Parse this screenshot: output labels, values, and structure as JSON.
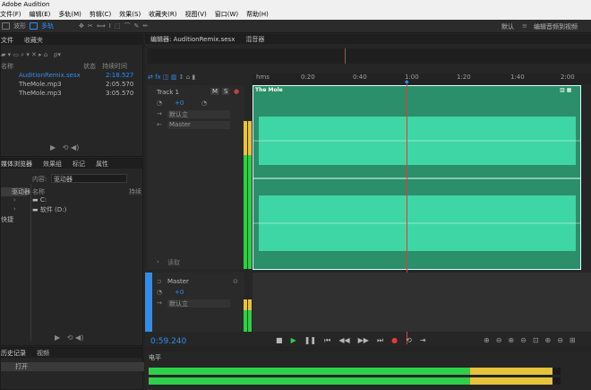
{
  "app": {
    "title": "Adobe Audition"
  },
  "menu": [
    "文件(F)",
    "编辑(E)",
    "多轨(M)",
    "剪辑(C)",
    "效果(S)",
    "收藏夹(R)",
    "视图(V)",
    "窗口(W)",
    "帮助(H)"
  ],
  "toolbar": {
    "waveform_label": "波形",
    "multitrack_label": "多轨",
    "default_label": "默认",
    "edit_audio_video_label": "编辑音频到视频"
  },
  "files_panel": {
    "tabs": [
      "文件",
      "收藏夹"
    ],
    "columns": [
      "名称",
      "状态",
      "持续时间"
    ],
    "files": [
      {
        "name": "AuditionRemix.sesx",
        "duration": "2:18.527",
        "active": true
      },
      {
        "name": "TheMole.mp3",
        "duration": "2:05.570",
        "active": false
      },
      {
        "name": "TheMole.mp3",
        "duration": "3:05.570",
        "active": false
      }
    ]
  },
  "media_panel": {
    "tabs": [
      "媒体浏览器",
      "效果组",
      "标记",
      "属性"
    ],
    "content_label": "内容:",
    "content_value": "驱动器",
    "name_column": "名称",
    "rows": [
      "驱动器",
      "C:",
      "软件 (D:)",
      "快捷"
    ],
    "shortcut_label": "快捷",
    "drive_label": "驱动器",
    "right_label": "持续"
  },
  "history_panel": {
    "tabs": [
      "历史记录",
      "视频"
    ],
    "item": "打开"
  },
  "editor": {
    "tabs": [
      "编辑器: AuditionRemix.sesx",
      "混音器"
    ],
    "time_ruler": [
      "hms",
      "0:20",
      "0:40",
      "1:00",
      "1:20",
      "1:40",
      "2:00"
    ],
    "current_time": "0:59.240",
    "track1": {
      "name": "Track 1",
      "volume": "+0",
      "clip_name": "The Mole",
      "input_label": "默认立",
      "output_label": "Master"
    },
    "master": {
      "name": "Master",
      "volume": "+0",
      "output_label": "默认立"
    },
    "ms_buttons": [
      "M",
      "S"
    ],
    "bottom_label": "读取"
  },
  "levels_panel": {
    "title": "电平",
    "levels": [
      0.8,
      0.95
    ]
  },
  "colors": {
    "accent": "#2e8ef0",
    "wave": "#3ed6a4",
    "waveBg": "#2a8f6a",
    "playhead": "#e23b3b"
  }
}
